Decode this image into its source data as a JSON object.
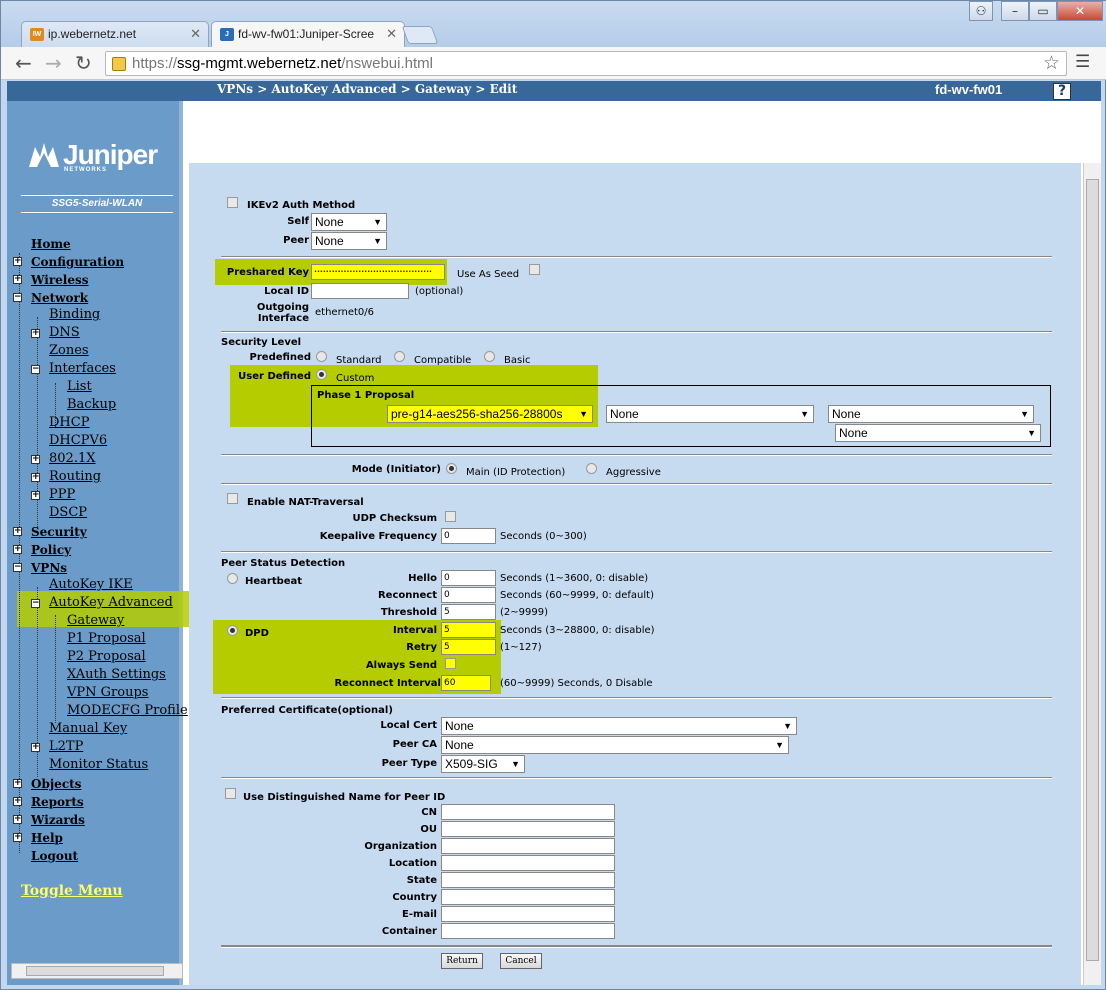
{
  "browser": {
    "tabs": [
      {
        "title": "ip.webernetz.net",
        "active": false
      },
      {
        "title": "fd-wv-fw01:Juniper-Scree",
        "active": true
      }
    ],
    "url_scheme": "https://",
    "url_host": "ssg-mgmt.webernetz.net",
    "url_path": "/nswebui.html"
  },
  "header": {
    "breadcrumb": "VPNs > AutoKey Advanced > Gateway > Edit",
    "device": "fd-wv-fw01",
    "help": "?"
  },
  "sidebar": {
    "brand": "Juniper",
    "brand_sub": "NETWORKS",
    "model": "SSG5-Serial-WLAN",
    "items": {
      "home": "Home",
      "configuration": "Configuration",
      "wireless": "Wireless",
      "network": "Network",
      "binding": "Binding",
      "dns": "DNS",
      "zones": "Zones",
      "interfaces": "Interfaces",
      "list": "List",
      "backup": "Backup",
      "dhcp": "DHCP",
      "dhcpv6": "DHCPV6",
      "dot1x": "802.1X",
      "routing": "Routing",
      "ppp": "PPP",
      "dscp": "DSCP",
      "security": "Security",
      "policy": "Policy",
      "vpns": "VPNs",
      "autokey_ike": "AutoKey IKE",
      "autokey_advanced": "AutoKey Advanced",
      "gateway": "Gateway",
      "p1_proposal": "P1 Proposal",
      "p2_proposal": "P2 Proposal",
      "xauth": "XAuth Settings",
      "vpn_groups": "VPN Groups",
      "modecfg": "MODECFG Profile",
      "manual_key": "Manual Key",
      "l2tp": "L2TP",
      "monitor_status": "Monitor Status",
      "objects": "Objects",
      "reports": "Reports",
      "wizards": "Wizards",
      "help": "Help",
      "logout": "Logout"
    },
    "toggle_menu": "Toggle Menu"
  },
  "form": {
    "ikev2_auth_method": "IKEv2 Auth Method",
    "self_label": "Self",
    "self_value": "None",
    "peer_label": "Peer",
    "peer_value": "None",
    "preshared_key_label": "Preshared Key",
    "preshared_key_value": "••••••••••••••••••••••••••••••••••••••••",
    "use_as_seed": "Use As Seed",
    "local_id_label": "Local ID",
    "local_id_value": "",
    "optional": "(optional)",
    "outgoing_interface_label1": "Outgoing",
    "outgoing_interface_label2": "Interface",
    "outgoing_interface_value": "ethernet0/6",
    "security_level": "Security Level",
    "predefined": "Predefined",
    "standard": "Standard",
    "compatible": "Compatible",
    "basic": "Basic",
    "user_defined": "User Defined",
    "custom": "Custom",
    "phase1_proposal": "Phase 1 Proposal",
    "proposal1": "pre-g14-aes256-sha256-28800s",
    "proposal2": "None",
    "proposal3": "None",
    "proposal4": "None",
    "mode_initiator": "Mode (Initiator)",
    "main_mode": "Main (ID Protection)",
    "aggressive": "Aggressive",
    "enable_nat_traversal": "Enable NAT-Traversal",
    "udp_checksum": "UDP Checksum",
    "keepalive_frequency": "Keepalive Frequency",
    "keepalive_value": "0",
    "keepalive_hint": "Seconds (0~300)",
    "peer_status_detection": "Peer Status Detection",
    "heartbeat": "Heartbeat",
    "hello_label": "Hello",
    "hello_value": "0",
    "hello_hint": "Seconds (1~3600, 0: disable)",
    "reconnect_label": "Reconnect",
    "reconnect_value": "0",
    "reconnect_hint": "Seconds (60~9999, 0: default)",
    "threshold_label": "Threshold",
    "threshold_value": "5",
    "threshold_hint": "(2~9999)",
    "dpd": "DPD",
    "interval_label": "Interval",
    "interval_value": "5",
    "interval_hint": "Seconds (3~28800, 0: disable)",
    "retry_label": "Retry",
    "retry_value": "5",
    "retry_hint": "(1~127)",
    "always_send": "Always Send",
    "reconnect_interval_label": "Reconnect Interval",
    "reconnect_interval_value": "60",
    "reconnect_interval_hint": "(60~9999) Seconds, 0 Disable",
    "preferred_certificate": "Preferred Certificate(optional)",
    "local_cert_label": "Local Cert",
    "local_cert_value": "None",
    "peer_ca_label": "Peer CA",
    "peer_ca_value": "None",
    "peer_type_label": "Peer Type",
    "peer_type_value": "X509-SIG",
    "use_dn": "Use Distinguished Name for Peer ID",
    "cn": "CN",
    "ou": "OU",
    "organization": "Organization",
    "location": "Location",
    "state": "State",
    "country": "Country",
    "email": "E-mail",
    "container": "Container",
    "return_button": "Return",
    "cancel_button": "Cancel"
  },
  "colors": {
    "highlight": "#b4cc00",
    "yellow_field": "#ffff00",
    "header_blue": "#38679a",
    "sidebar_blue": "#6a9bc9",
    "content_bg": "#c6daf0"
  }
}
